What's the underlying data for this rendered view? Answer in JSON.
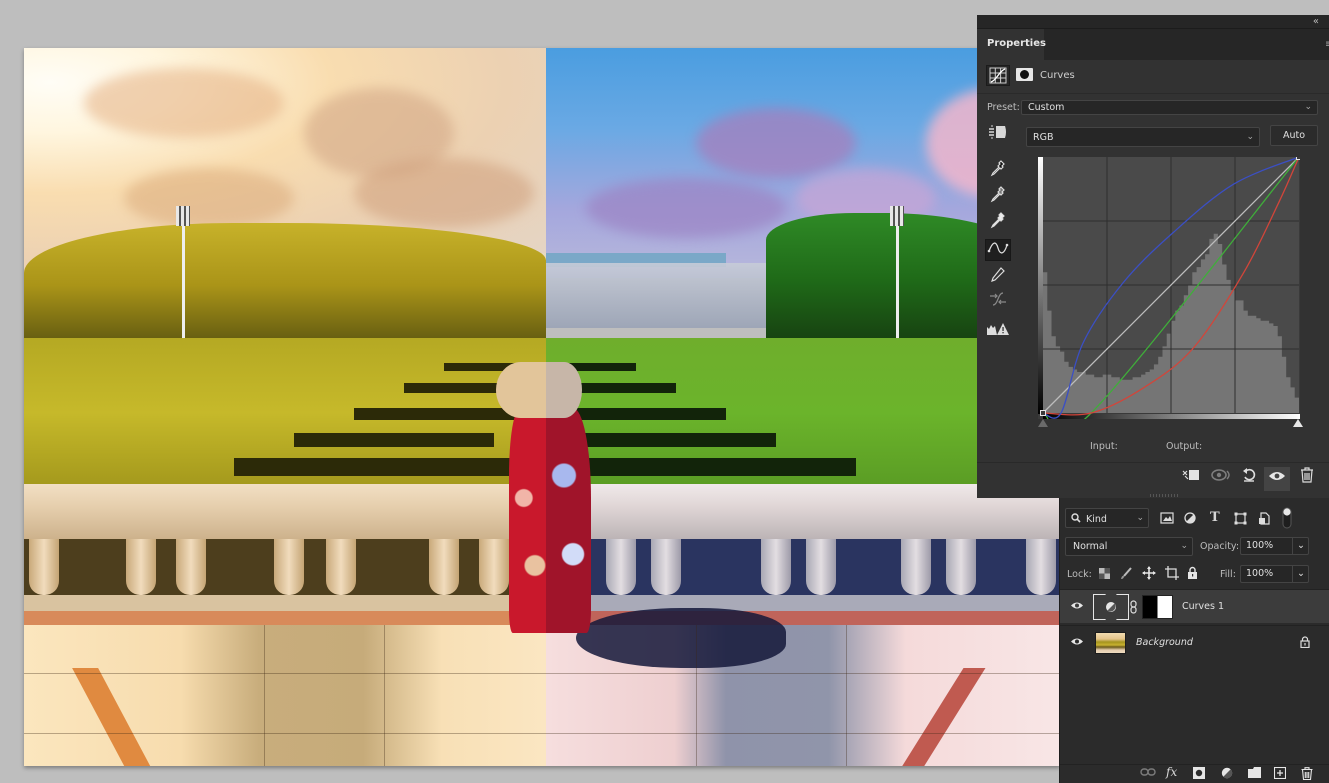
{
  "app": {
    "canvas": {
      "description": "before-after split photo of park with woman in hat",
      "left_half_tone": "warm",
      "right_half_tone": "cool"
    }
  },
  "properties_panel": {
    "tab_label": "Properties",
    "collapse_glyph": "«",
    "menu_glyph": "≡",
    "adjustment_title": "Curves",
    "preset_label": "Preset:",
    "preset_value": "Custom",
    "channel_value": "RGB",
    "auto_label": "Auto",
    "input_label": "Input:",
    "output_label": "Output:",
    "tools": [
      {
        "name": "on-image-adjust",
        "glyph": "☚"
      },
      {
        "name": "black-point-eyedropper",
        "glyph": "✎"
      },
      {
        "name": "gray-point-eyedropper",
        "glyph": "✎"
      },
      {
        "name": "white-point-eyedropper",
        "glyph": "✎"
      },
      {
        "name": "edit-points-curve",
        "glyph": "∿"
      },
      {
        "name": "draw-pencil",
        "glyph": "✏"
      },
      {
        "name": "smooth-curve",
        "glyph": "⇄"
      },
      {
        "name": "clipping-warning",
        "glyph": "▲"
      }
    ],
    "curves": {
      "rgb": [
        [
          0,
          0
        ],
        [
          255,
          255
        ]
      ],
      "blue": [
        [
          0,
          0
        ],
        [
          18,
          0
        ],
        [
          40,
          70
        ],
        [
          80,
          130
        ],
        [
          130,
          180
        ],
        [
          190,
          228
        ],
        [
          255,
          255
        ]
      ],
      "green": [
        [
          0,
          0
        ],
        [
          48,
          0
        ],
        [
          255,
          255
        ]
      ],
      "red": [
        [
          0,
          0
        ],
        [
          48,
          0
        ],
        [
          100,
          25
        ],
        [
          150,
          65
        ],
        [
          200,
          140
        ],
        [
          235,
          210
        ],
        [
          255,
          255
        ]
      ]
    },
    "curve_colors": {
      "rgb": "#bdbdbd",
      "red": "#d2453a",
      "green": "#3fae3a",
      "blue": "#3b4fc4"
    },
    "histogram_percent": [
      55,
      40,
      30,
      26,
      24,
      20,
      18,
      17,
      16,
      16,
      15,
      15,
      14,
      14,
      15,
      15,
      14,
      14,
      13,
      13,
      13,
      14,
      14,
      15,
      16,
      17,
      19,
      22,
      26,
      31,
      36,
      40,
      42,
      46,
      50,
      55,
      57,
      60,
      62,
      68,
      70,
      66,
      58,
      52,
      48,
      44,
      44,
      40,
      38,
      38,
      37,
      36,
      36,
      35,
      34,
      30,
      22,
      14,
      10,
      6
    ],
    "bottom_tools": [
      {
        "name": "clip-to-layer",
        "glyph": "⬚"
      },
      {
        "name": "view-previous-state",
        "glyph": "◉"
      },
      {
        "name": "reset",
        "glyph": "↺"
      },
      {
        "name": "toggle-visibility",
        "glyph": "👁"
      },
      {
        "name": "delete",
        "glyph": "🗑"
      }
    ]
  },
  "layers_panel": {
    "filter_kind": "Kind",
    "filter_icons": [
      "image",
      "adjustment",
      "type",
      "shape",
      "smart-object"
    ],
    "blend_mode": "Normal",
    "opacity_label": "Opacity:",
    "opacity_value": "100%",
    "lock_label": "Lock:",
    "fill_label": "Fill:",
    "fill_value": "100%",
    "layers": [
      {
        "name": "Curves 1",
        "type": "adjustment",
        "visible": true,
        "selected": true
      },
      {
        "name": "Background",
        "type": "image",
        "visible": true,
        "locked": true,
        "selected": false
      }
    ],
    "footer_icons": [
      "link-layers",
      "fx",
      "add-mask",
      "new-adjustment",
      "new-group",
      "new-layer",
      "delete-layer"
    ]
  }
}
